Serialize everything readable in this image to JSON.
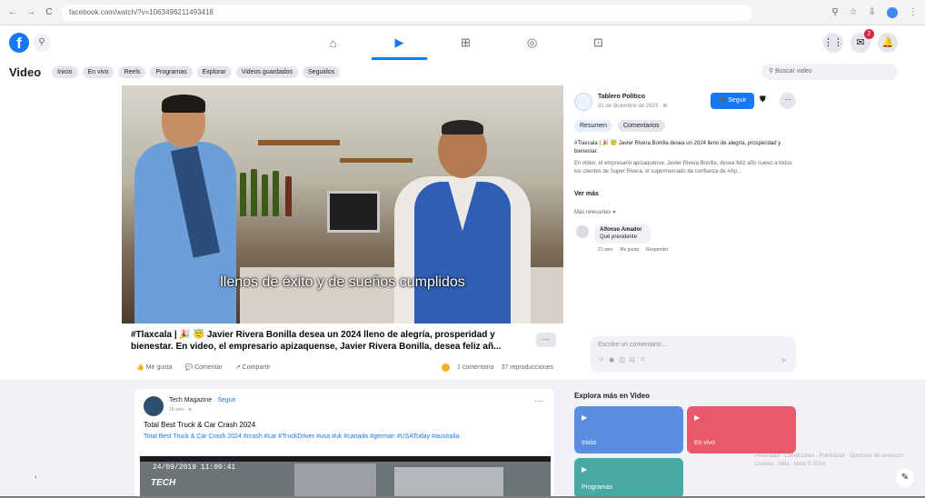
{
  "browser": {
    "nav": [
      "←",
      "→",
      "C",
      "⌂"
    ],
    "url": "facebook.com/watch/?v=1063496211493418",
    "icons": [
      "⚲",
      "☆",
      "⇩",
      "⋮"
    ]
  },
  "topbar": {
    "logo": "f",
    "search_icon": "⚲",
    "nav_tabs": [
      {
        "icon": "⌂",
        "name": "home"
      },
      {
        "icon": "▶",
        "name": "video"
      },
      {
        "icon": "⊞",
        "name": "marketplace"
      },
      {
        "icon": "◎",
        "name": "groups"
      },
      {
        "icon": "⊡",
        "name": "gaming"
      }
    ],
    "right_icons": [
      "⋮⋮",
      "✉",
      "🔔"
    ],
    "notif_count": "2"
  },
  "video_header": {
    "title": "Video",
    "pills": [
      "Inicio",
      "En vivo",
      "Reels",
      "Programas",
      "Explorar",
      "Videos guardados",
      "Seguidos"
    ],
    "search_placeholder": "⚲ Buscar video"
  },
  "video": {
    "caption": "llenos de éxito y de sueños cumplidos"
  },
  "post": {
    "text": "#Tlaxcala | 🎉 😇 Javier Rivera Bonilla desea un 2024 lleno de alegría, prosperidad y bienestar. En video, el empresario apizaquense, Javier Rivera Bonilla, desea feliz añ...",
    "more": "...",
    "actions": [
      "👍 Me gusta",
      "💬 Comentar",
      "↗ Compartir"
    ],
    "stats": [
      "1 comentario",
      "37 reproducciones"
    ]
  },
  "right": {
    "page_name": "Tablero Político",
    "page_meta": "31 de diciembre de 2023 · ⊕",
    "follow_label": "➕ Seguir",
    "save_icon": "⛊",
    "more_icon": "···",
    "tabs": [
      "Resumen",
      "Comentarios"
    ],
    "desc_strong": "#Tlaxcala | 🎉 😇 Javier Rivera Bonilla desea un 2024 lleno de alegría, prosperidad y bienestar.",
    "desc": "En video, el empresario apizaquense, Javier Rivera Bonilla, desea feliz año nuevo a todos los clientes de Super Rivera, el supermercado de confianza de #Ap...",
    "more_label": "Ver más",
    "relevant": "Más relevantes ▾",
    "comment_name": "Alfonso Amador",
    "comment_text": "Qué presidente",
    "comment_meta": [
      "21 sem",
      "Me gusta",
      "Responder"
    ],
    "comment_placeholder": "Escribe un comentario...",
    "comment_icons": [
      "☺",
      "◉",
      "◫",
      "⊡",
      "☺"
    ],
    "send_icon": "➤"
  },
  "card": {
    "name": "Tech Magazine",
    "follow": "· Seguir",
    "time": "19 sem · ⊕",
    "dots": "···",
    "title": "Total Best Truck & Car Crash 2024",
    "tags_text": "Total Best Truck & Car Crash 2024 ",
    "tags": "#crash #car #TruckDriver #usa #uk #canada #german #USAToday #australia",
    "timestamp": "24/09/2019 11:00:41",
    "brand": "TECH"
  },
  "explore": {
    "title": "Explora más en Video",
    "tiles": [
      {
        "icon": "▶",
        "label": "Inicio"
      },
      {
        "icon": "▶",
        "label": "En vivo"
      },
      {
        "icon": "▶",
        "label": "Programas"
      }
    ],
    "faint": "Privacidad · Condiciones · Publicidad · Opciones de anuncios · Cookies · Más · Meta © 2024"
  },
  "edit_icon": "✎",
  "chevron": "‹"
}
